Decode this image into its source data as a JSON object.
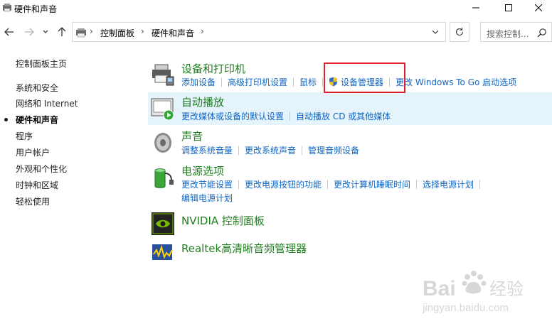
{
  "window": {
    "title": "硬件和声音"
  },
  "address_bar": {
    "crumbs": [
      "控制面板",
      "硬件和声音"
    ],
    "search_placeholder": "搜索控制..."
  },
  "sidebar": {
    "items": [
      {
        "label": "控制面板主页"
      },
      {
        "label": "系统和安全"
      },
      {
        "label": "网络和 Internet"
      },
      {
        "label": "硬件和声音",
        "active": true
      },
      {
        "label": "程序"
      },
      {
        "label": "用户帐户"
      },
      {
        "label": "外观和个性化"
      },
      {
        "label": "时钟和区域"
      },
      {
        "label": "轻松使用"
      }
    ]
  },
  "categories": [
    {
      "title": "设备和打印机",
      "icon": "printer-icon",
      "links": [
        "添加设备",
        "高级打印机设置",
        "鼠标",
        "设备管理器",
        "更改 Windows To Go 启动选项"
      ]
    },
    {
      "title": "自动播放",
      "icon": "autoplay-icon",
      "links": [
        "更改媒体或设备的默认设置",
        "自动播放 CD 或其他媒体"
      ]
    },
    {
      "title": "声音",
      "icon": "speaker-icon",
      "links": [
        "调整系统音量",
        "更改系统声音",
        "管理音频设备"
      ]
    },
    {
      "title": "电源选项",
      "icon": "battery-icon",
      "links": [
        "更改节能设置",
        "更改电源按钮的功能",
        "更改计算机睡眠时间",
        "选择电源计划"
      ],
      "links2": [
        "编辑电源计划"
      ]
    },
    {
      "title": "NVIDIA 控制面板",
      "icon": "nvidia-icon",
      "links": []
    },
    {
      "title": "Realtek高清晰音频管理器",
      "icon": "realtek-icon",
      "links": []
    }
  ],
  "watermark": {
    "line1": "Bai",
    "line1b": "经验",
    "line2": "jingyan.baidu.com"
  },
  "colors": {
    "link": "#1066c4",
    "category_title": "#1e7e1e",
    "hover_row": "#e5f3fb",
    "highlight": "#e0202a"
  }
}
